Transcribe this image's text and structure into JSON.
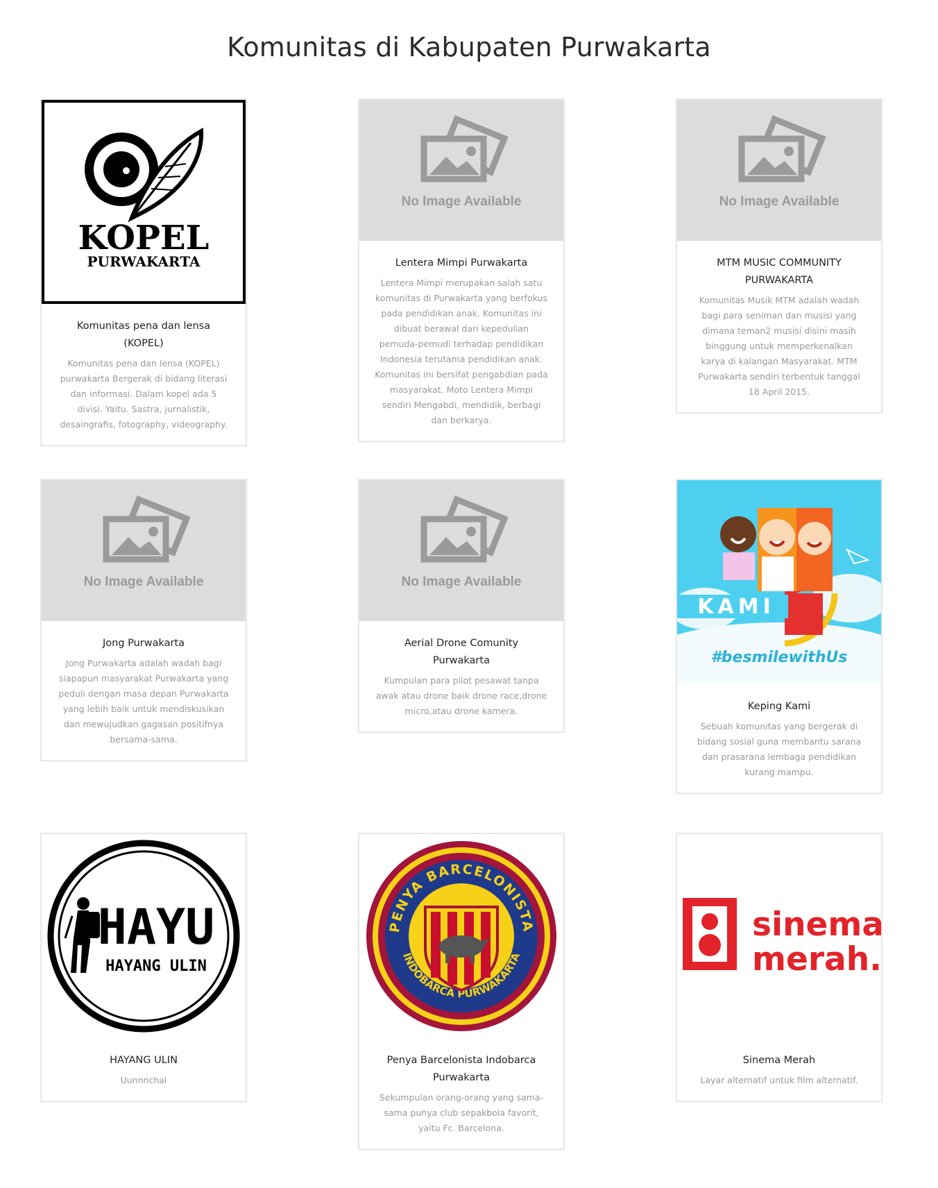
{
  "page": {
    "title": "Komunitas di Kabupaten Purwakarta"
  },
  "placeholder": {
    "text": "No Image Available"
  },
  "logos": {
    "kopel": {
      "main": "KOPEL",
      "sub": "PURWAKARTA"
    },
    "keping_kami": {
      "band": "KAMI",
      "hashtag": "#besmilewithUs"
    },
    "hayu": {
      "main": "HAYU",
      "sub": "HAYANG ULIN"
    },
    "barca": {
      "top": "PENYA BARCELONISTA",
      "bottom": "INDOBARCA PURWAKARTA"
    },
    "sinema": {
      "line1": "sinema",
      "line2": "merah."
    }
  },
  "colors": {
    "placeholder_bg": "#dcdcdc",
    "placeholder_icon": "#9a9a9a",
    "sinema_red": "#e2232a",
    "barca_red": "#a3153b",
    "barca_yellow": "#f7d117",
    "sky_blue": "#4dd0f0"
  },
  "cards": [
    {
      "title": "Komunitas pena dan lensa (KOPEL)",
      "desc": "Komunitas pena dan lensa (KOPEL) purwakarta Bergerak di bidang literasi dan informasi. Dalam kopel ada 5 divisi. Yaitu. Sastra, jurnalistik, desaingrafis, fotography, videography."
    },
    {
      "title": "Lentera Mimpi Purwakarta",
      "desc": "Lentera Mimpi merupakan salah satu komunitas di Purwakarta yang berfokus pada pendidikan anak. Komunitas ini dibuat berawal dari kepedulian pemuda-pemudi terhadap pendidikan Indonesia terutama pendidikan anak. Komunitas ini bersifat pengabdian pada masyarakat. Moto Lentera Mimpi sendiri Mengabdi, mendidik, berbagi dan berkarya."
    },
    {
      "title": "MTM MUSIC COMMUNITY PURWAKARTA",
      "desc": "Komunitas Musik MTM adalah wadah bagi para seniman dan musisi yang dimana teman2 musisi disini masih binggung untuk memperkenalkan karya di kalangan Masyarakat. MTM Purwakarta sendiri terbentuk tanggal 18 April 2015."
    },
    {
      "title": "Jong Purwakarta",
      "desc": "Jong Purwakarta adalah wadah bagi siapapun masyarakat Purwakarta yang peduli dengan masa depan Purwakarta yang lebih baik untuk mendiskusikan dan mewujudkan gagasan positifnya bersama-sama."
    },
    {
      "title": "Aerial Drone Comunity Purwakarta",
      "desc": "Kumpulan para pilot pesawat tanpa awak atau drone baik drone race,drone micro,atau drone kamera."
    },
    {
      "title": "Keping Kami",
      "desc": "Sebuah komunitas yang bergerak di bidang sosial guna membantu sarana dan prasarana lembaga pendidikan kurang mampu."
    },
    {
      "title": "HAYANG ULIN",
      "desc": "Uunnnchal"
    },
    {
      "title": "Penya Barcelonista Indobarca Purwakarta",
      "desc": "Sekumpulan orang-orang yang sama-sama punya club sepakbola favorit, yaitu Fc. Barcelona."
    },
    {
      "title": "Sinema Merah",
      "desc": "Layar alternatif untuk film alternatif."
    }
  ]
}
